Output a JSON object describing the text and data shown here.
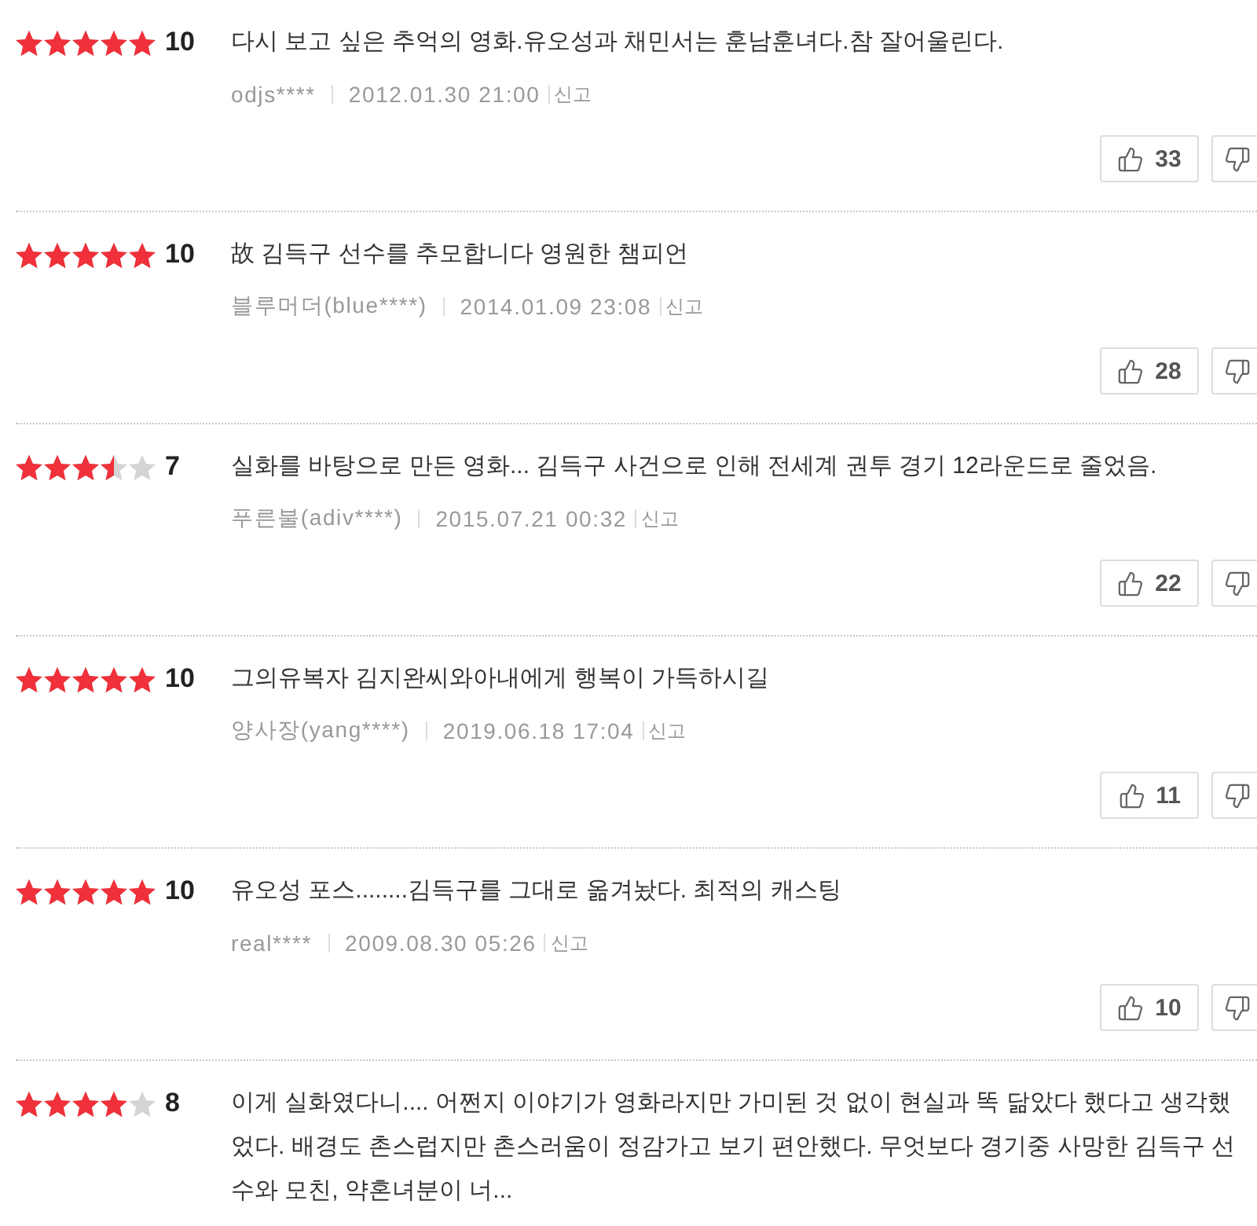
{
  "reviews": [
    {
      "stars": 5,
      "score": "10",
      "text": "다시 보고 싶은 추억의 영화.유오성과 채민서는 훈남훈녀다.참 잘어울린다.",
      "user": "odjs****",
      "date": "2012.01.30 21:00",
      "report": "신고",
      "likes": "33"
    },
    {
      "stars": 5,
      "score": "10",
      "text": "故 김득구 선수를 추모합니다 영원한 챔피언",
      "user": "블루머더(blue****)",
      "date": "2014.01.09 23:08",
      "report": "신고",
      "likes": "28"
    },
    {
      "stars": 3.5,
      "score": "7",
      "text": "실화를 바탕으로 만든 영화... 김득구 사건으로 인해 전세계 권투 경기 12라운드로 줄었음.",
      "user": "푸른불(adiv****)",
      "date": "2015.07.21 00:32",
      "report": "신고",
      "likes": "22"
    },
    {
      "stars": 5,
      "score": "10",
      "text": "그의유복자 김지완씨와아내에게 행복이 가득하시길",
      "user": "양사장(yang****)",
      "date": "2019.06.18 17:04",
      "report": "신고",
      "likes": "11"
    },
    {
      "stars": 5,
      "score": "10",
      "text": "유오성 포스........김득구를 그대로 옮겨놨다. 최적의 캐스팅",
      "user": "real****",
      "date": "2009.08.30 05:26",
      "report": "신고",
      "likes": "10"
    },
    {
      "stars": 4,
      "score": "8",
      "text": "이게 실화였다니.... 어쩐지 이야기가 영화라지만 가미된 것 없이 현실과 똑 닮았다 했다고 생각했었다. 배경도 촌스럽지만 촌스러움이 정감가고 보기 편안했다. 무엇보다 경기중 사망한 김득구 선수와 모친, 약혼녀분이 너..."
    }
  ]
}
